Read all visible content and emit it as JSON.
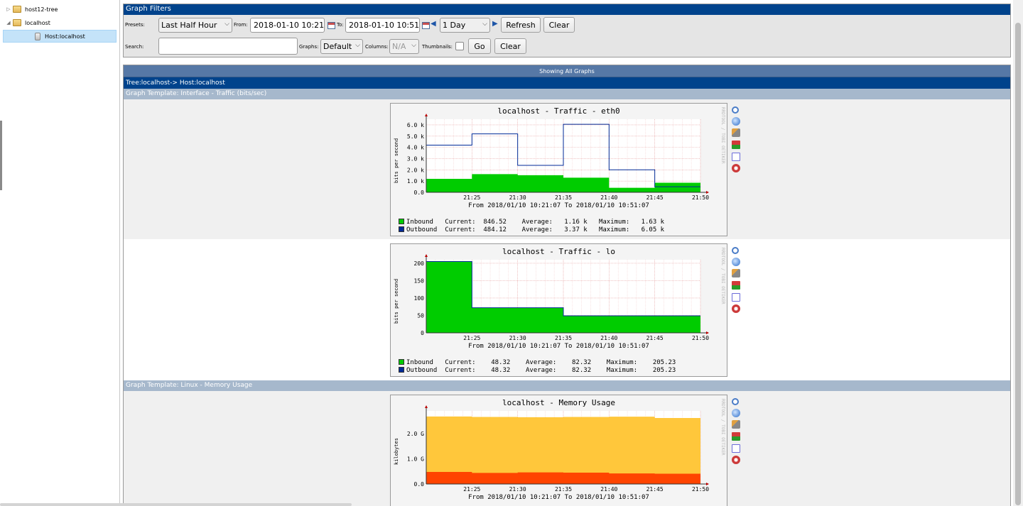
{
  "tree": {
    "items": [
      {
        "label": "host12-tree",
        "expanded": false
      },
      {
        "label": "localhost",
        "expanded": true
      },
      {
        "label": "Host:localhost",
        "selected": true
      }
    ]
  },
  "filters": {
    "header": "Graph Filters",
    "presets_label": "Presets:",
    "presets_value": "Last Half Hour",
    "from_label": "From:",
    "from_value": "2018-01-10 10:21",
    "to_label": "To:",
    "to_value": "2018-01-10 10:51",
    "timespan_value": "1 Day",
    "refresh_label": "Refresh",
    "clear_label": "Clear",
    "search_label": "Search:",
    "search_value": "",
    "graphs_label": "Graphs:",
    "graphs_value": "Default",
    "columns_label": "Columns:",
    "columns_value": "N/A",
    "thumbnails_label": "Thumbnails:",
    "thumbnails_checked": false,
    "go_label": "Go",
    "clear2_label": "Clear"
  },
  "panel": {
    "showing": "Showing All Graphs",
    "breadcrumb": "Tree:localhost-> Host:localhost"
  },
  "templates": [
    "Graph Template: Interface - Traffic (bits/sec)",
    "Graph Template: Linux - Memory Usage"
  ],
  "graphs": [
    {
      "title": "localhost - Traffic - eth0",
      "vertical_label": "bits per second",
      "watermark": "RRDTOOL / TOBI OETIKER",
      "from_to": "From 2018/01/10 10:21:07 To 2018/01/10 10:51:07",
      "legend": [
        {
          "name": "Inbound",
          "color": "#00cc00",
          "current": "846.52",
          "average": "1.16 k",
          "maximum": "1.63 k"
        },
        {
          "name": "Outbound",
          "color": "#002a97",
          "current": "484.12",
          "average": "3.37 k",
          "maximum": "6.05 k"
        }
      ]
    },
    {
      "title": "localhost - Traffic - lo",
      "vertical_label": "bits per second",
      "watermark": "RRDTOOL / TOBI OETIKER",
      "from_to": "From 2018/01/10 10:21:07 To 2018/01/10 10:51:07",
      "legend": [
        {
          "name": "Inbound",
          "color": "#00cc00",
          "current": "48.32",
          "average": "82.32",
          "maximum": "205.23"
        },
        {
          "name": "Outbound",
          "color": "#002a97",
          "current": "48.32",
          "average": "82.32",
          "maximum": "205.23"
        }
      ]
    },
    {
      "title": "localhost - Memory Usage",
      "vertical_label": "kilobytes",
      "watermark": "RRDTOOL / TOBI OETIKER",
      "from_to": "From 2018/01/10 10:21:07 To 2018/01/10 10:51:07",
      "legend": []
    }
  ],
  "chart_data": [
    {
      "type": "line",
      "title": "localhost - Traffic - eth0",
      "ylabel": "bits per second",
      "x": [
        "21:21",
        "21:25",
        "21:30",
        "21:35",
        "21:40",
        "21:45",
        "21:50"
      ],
      "x_ticks": [
        "21:25",
        "21:30",
        "21:35",
        "21:40",
        "21:45",
        "21:50"
      ],
      "y_ticks": [
        "0.0",
        "1.0 k",
        "2.0 k",
        "3.0 k",
        "4.0 k",
        "5.0 k",
        "6.0 k"
      ],
      "ylim": [
        0,
        6500
      ],
      "grid": true,
      "series": [
        {
          "name": "Inbound",
          "kind": "area",
          "color": "#00cc00",
          "values": [
            1200,
            1620,
            1520,
            1300,
            400,
            850,
            850
          ]
        },
        {
          "name": "Outbound",
          "kind": "line",
          "color": "#002a97",
          "values": [
            4200,
            5200,
            2400,
            6050,
            2000,
            500,
            500
          ]
        }
      ]
    },
    {
      "type": "area",
      "title": "localhost - Traffic - lo",
      "ylabel": "bits per second",
      "x": [
        "21:21",
        "21:25",
        "21:30",
        "21:35",
        "21:40",
        "21:45",
        "21:50"
      ],
      "x_ticks": [
        "21:25",
        "21:30",
        "21:35",
        "21:40",
        "21:45",
        "21:50"
      ],
      "y_ticks": [
        "0",
        "50",
        "100",
        "150",
        "200"
      ],
      "ylim": [
        0,
        210
      ],
      "grid": true,
      "series": [
        {
          "name": "Inbound",
          "kind": "area",
          "color": "#00cc00",
          "values": [
            205,
            72,
            72,
            49,
            49,
            49,
            49
          ]
        },
        {
          "name": "Outbound",
          "kind": "line",
          "color": "#002a97",
          "values": [
            205,
            72,
            72,
            49,
            49,
            49,
            49
          ]
        }
      ]
    },
    {
      "type": "area",
      "title": "localhost - Memory Usage",
      "ylabel": "kilobytes",
      "x": [
        "21:21",
        "21:25",
        "21:30",
        "21:35",
        "21:40",
        "21:45",
        "21:50"
      ],
      "x_ticks": [
        "21:25",
        "21:30",
        "21:35",
        "21:40",
        "21:45",
        "21:50"
      ],
      "y_ticks": [
        "0.0",
        "1.0 G",
        "2.0 G"
      ],
      "ylim": [
        0,
        2900000
      ],
      "grid": true,
      "series": [
        {
          "kind": "area",
          "color": "#ff4400",
          "values": [
            480000,
            440000,
            460000,
            450000,
            420000,
            410000,
            410000
          ]
        },
        {
          "kind": "area",
          "color": "#ffc73b",
          "values": [
            2680000,
            2660000,
            2650000,
            2660000,
            2670000,
            2620000,
            2620000
          ]
        }
      ]
    }
  ]
}
